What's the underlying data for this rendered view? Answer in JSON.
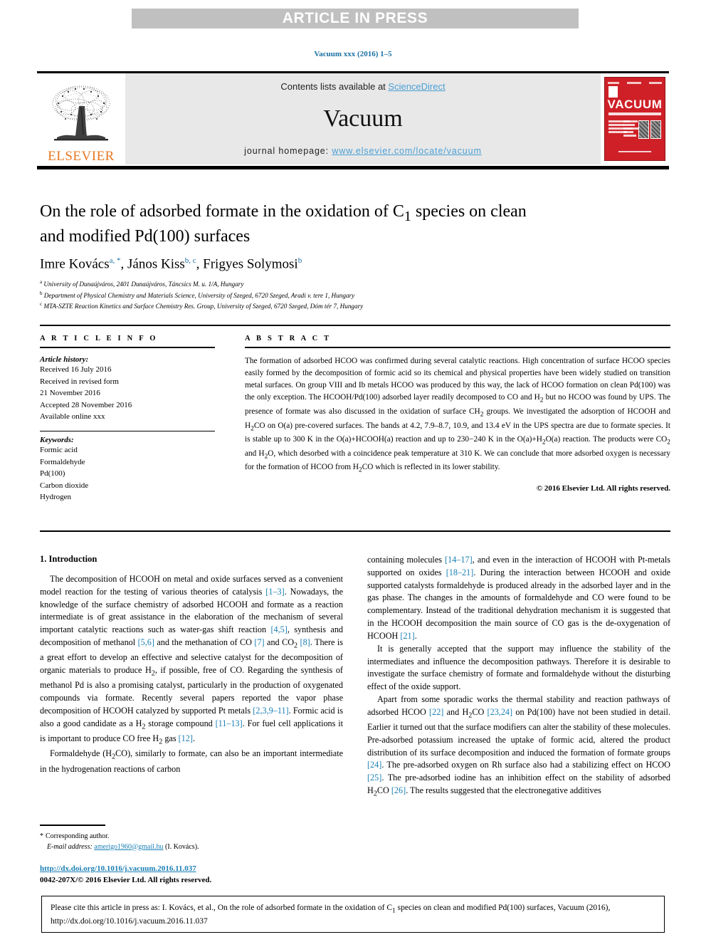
{
  "banner": {
    "text": "ARTICLE IN PRESS"
  },
  "running_head": "Vacuum xxx (2016) 1–5",
  "masthead": {
    "contents_prefix": "Contents lists available at ",
    "sciencedirect": "ScienceDirect",
    "journal_name": "Vacuum",
    "homepage_label": "journal homepage: ",
    "homepage_url": "www.elsevier.com/locate/vacuum",
    "publisher_logo_text": "ELSEVIER",
    "cover_title": "VACUUM"
  },
  "article": {
    "title": "On the role of adsorbed formate in the oxidation of C₁ species on clean and modified Pd(100) surfaces",
    "title_line1_a": "On the role of adsorbed formate in the oxidation of C",
    "title_line1_sub": "1",
    "title_line1_b": " species on clean",
    "title_line2": "and modified Pd(100) surfaces",
    "authors": [
      {
        "name": "Imre Kovács",
        "marks": "a, *"
      },
      {
        "name": "János Kiss",
        "marks": "b, c"
      },
      {
        "name": "Frigyes Solymosi",
        "marks": "b"
      }
    ],
    "affiliations": [
      {
        "mark": "a",
        "text": "University of Dunaújváros, 2401 Dunaújváros, Táncsics M. u. 1/A, Hungary"
      },
      {
        "mark": "b",
        "text": "Department of Physical Chemistry and Materials Science, University of Szeged, 6720 Szeged, Aradi v. tere 1, Hungary"
      },
      {
        "mark": "c",
        "text": "MTA-SZTE Reaction Kinetics and Surface Chemistry Res. Group, University of Szeged, 6720 Szeged, Dóm tér 7, Hungary"
      }
    ]
  },
  "article_info": {
    "heading": "A R T I C L E   I N F O",
    "history_label": "Article history:",
    "history": [
      "Received 16 July 2016",
      "Received in revised form",
      "21 November 2016",
      "Accepted 28 November 2016",
      "Available online xxx"
    ],
    "keywords_label": "Keywords:",
    "keywords": [
      "Formic acid",
      "Formaldehyde",
      "Pd(100)",
      "Carbon dioxide",
      "Hydrogen"
    ]
  },
  "abstract": {
    "heading": "A B S T R A C T",
    "text": "The formation of adsorbed HCOO was confirmed during several catalytic reactions. High concentration of surface HCOO species easily formed by the decomposition of formic acid so its chemical and physical properties have been widely studied on transition metal surfaces. On group VIII and Ib metals HCOO was produced by this way, the lack of HCOO formation on clean Pd(100) was the only exception. The HCOOH/Pd(100) adsorbed layer readily decomposed to CO and H2 but no HCOO was found by UPS. The presence of formate was also discussed in the oxidation of surface CH2 groups. We investigated the adsorption of HCOOH and H2CO on O(a) pre-covered surfaces. The bands at 4.2, 7.9–8.7, 10.9, and 13.4 eV in the UPS spectra are due to formate species. It is stable up to 300 K in the O(a)+HCOOH(a) reaction and up to 230−240 K in the O(a)+H2O(a) reaction. The products were CO2 and H2O, which desorbed with a coincidence peak temperature at 310 K. We can conclude that more adsorbed oxygen is necessary for the formation of HCOO from H2CO which is reflected in its lower stability.",
    "copyright": "© 2016 Elsevier Ltd. All rights reserved."
  },
  "introduction": {
    "heading": "1. Introduction",
    "left_paragraphs": [
      "The decomposition of HCOOH on metal and oxide surfaces served as a convenient model reaction for the testing of various theories of catalysis [1–3]. Nowadays, the knowledge of the surface chemistry of adsorbed HCOOH and formate as a reaction intermediate is of great assistance in the elaboration of the mechanism of several important catalytic reactions such as water-gas shift reaction [4,5], synthesis and decomposition of methanol [5,6] and the methanation of CO [7] and CO2 [8]. There is a great effort to develop an effective and selective catalyst for the decomposition of organic materials to produce H2, if possible, free of CO. Regarding the synthesis of methanol Pd is also a promising catalyst, particularly in the production of oxygenated compounds via formate. Recently several papers reported the vapor phase decomposition of HCOOH catalyzed by supported Pt metals [2,3,9–11]. Formic acid is also a good candidate as a H2 storage compound [11–13]. For fuel cell applications it is important to produce CO free H2 gas [12].",
      "Formaldehyde (H2CO), similarly to formate, can also be an important intermediate in the hydrogenation reactions of carbon"
    ],
    "right_paragraphs": [
      "containing molecules [14–17], and even in the interaction of HCOOH with Pt-metals supported on oxides [18–21]. During the interaction between HCOOH and oxide supported catalysts formaldehyde is produced already in the adsorbed layer and in the gas phase. The changes in the amounts of formaldehyde and CO were found to be complementary. Instead of the traditional dehydration mechanism it is suggested that in the HCOOH decomposition the main source of CO gas is the de-oxygenation of HCOOH [21].",
      "It is generally accepted that the support may influence the stability of the intermediates and influence the decomposition pathways. Therefore it is desirable to investigate the surface chemistry of formate and formaldehyde without the disturbing effect of the oxide support.",
      "Apart from some sporadic works the thermal stability and reaction pathways of adsorbed HCOO [22] and H2CO [23,24] on Pd(100) have not been studied in detail. Earlier it turned out that the surface modifiers can alter the stability of these molecules. Pre-adsorbed potassium increased the uptake of formic acid, altered the product distribution of its surface decomposition and induced the formation of formate groups [24]. The pre-adsorbed oxygen on Rh surface also had a stabilizing effect on HCOO [25]. The pre-adsorbed iodine has an inhibition effect on the stability of adsorbed H2CO [26]. The results suggested that the electronegative additives"
    ]
  },
  "footnote": {
    "corresponding_star": "*",
    "corresponding_label": "Corresponding author.",
    "email_label": "E-mail address:",
    "email": "amerigo1960@gmail.hu",
    "email_attrib": "(I. Kovács)."
  },
  "doi_block": {
    "doi": "http://dx.doi.org/10.1016/j.vacuum.2016.11.037",
    "issn_line": "0042-207X/© 2016 Elsevier Ltd. All rights reserved."
  },
  "citation_footer": {
    "text": "Please cite this article in press as: I. Kovács, et al., On the role of adsorbed formate in the oxidation of C1 species on clean and modified Pd(100) surfaces, Vacuum (2016), http://dx.doi.org/10.1016/j.vacuum.2016.11.037"
  },
  "colors": {
    "link_blue": "#1a7fb5",
    "sciencedirect_blue": "#4a9fd4",
    "elsevier_orange": "#e87722",
    "banner_gray": "#c0c0c0",
    "masthead_gray": "#e8e8e8",
    "cover_red": "#cf2027"
  }
}
